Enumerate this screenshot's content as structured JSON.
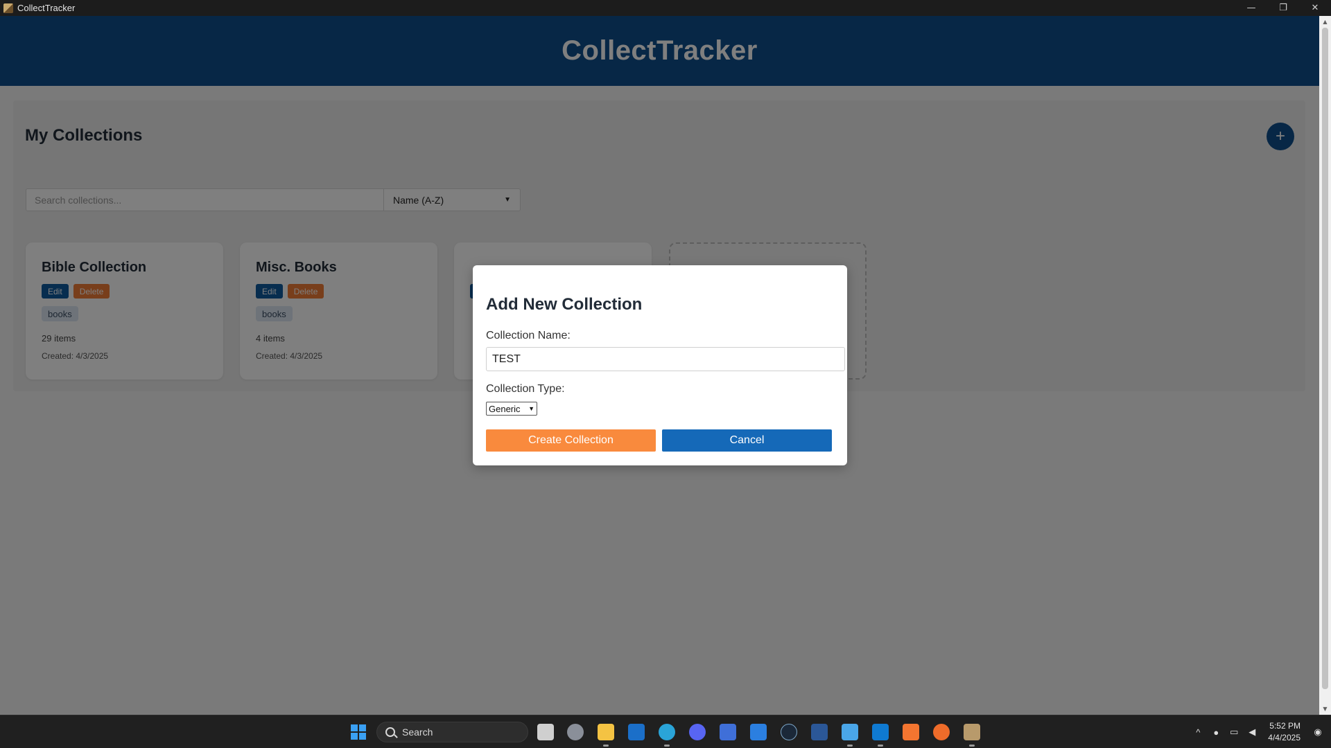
{
  "window": {
    "title": "CollectTracker",
    "controls": {
      "minimize": "—",
      "restore": "❐",
      "close": "✕"
    }
  },
  "header": {
    "app_name": "CollectTracker"
  },
  "collections_panel": {
    "title": "My Collections",
    "add_button_symbol": "+",
    "search": {
      "placeholder": "Search collections..."
    },
    "sort": {
      "selected": "Name (A-Z)"
    },
    "cards": [
      {
        "title": "Bible Collection",
        "edit_label": "Edit",
        "delete_label": "Delete",
        "tag": "books",
        "count": "29 items",
        "created": "Created: 4/3/2025"
      },
      {
        "title": "Misc. Books",
        "edit_label": "Edit",
        "delete_label": "Delete",
        "tag": "books",
        "count": "4 items",
        "created": "Created: 4/3/2025"
      }
    ]
  },
  "modal": {
    "title": "Add New Collection",
    "name_label": "Collection Name:",
    "name_value": "TEST",
    "type_label": "Collection Type:",
    "type_selected": "Generic",
    "create_label": "Create Collection",
    "cancel_label": "Cancel"
  },
  "taskbar": {
    "search_label": "Search",
    "icons": [
      "task-view-icon",
      "settings-icon",
      "file-explorer-icon",
      "outlook-icon",
      "edge-icon",
      "discord-icon",
      "app-icon",
      "bing-icon",
      "steam-icon",
      "word-icon",
      "notepad-icon",
      "vscode-icon",
      "xampp-icon",
      "postman-icon",
      "collecttracker-icon"
    ],
    "time": "5:52 PM",
    "date": "4/4/2025"
  },
  "colors": {
    "header_bg": "#0e4f8c",
    "edit_button": "#0e5a9e",
    "delete_button": "#f07c36",
    "create_button": "#f98a3d",
    "cancel_button": "#1569b8"
  }
}
